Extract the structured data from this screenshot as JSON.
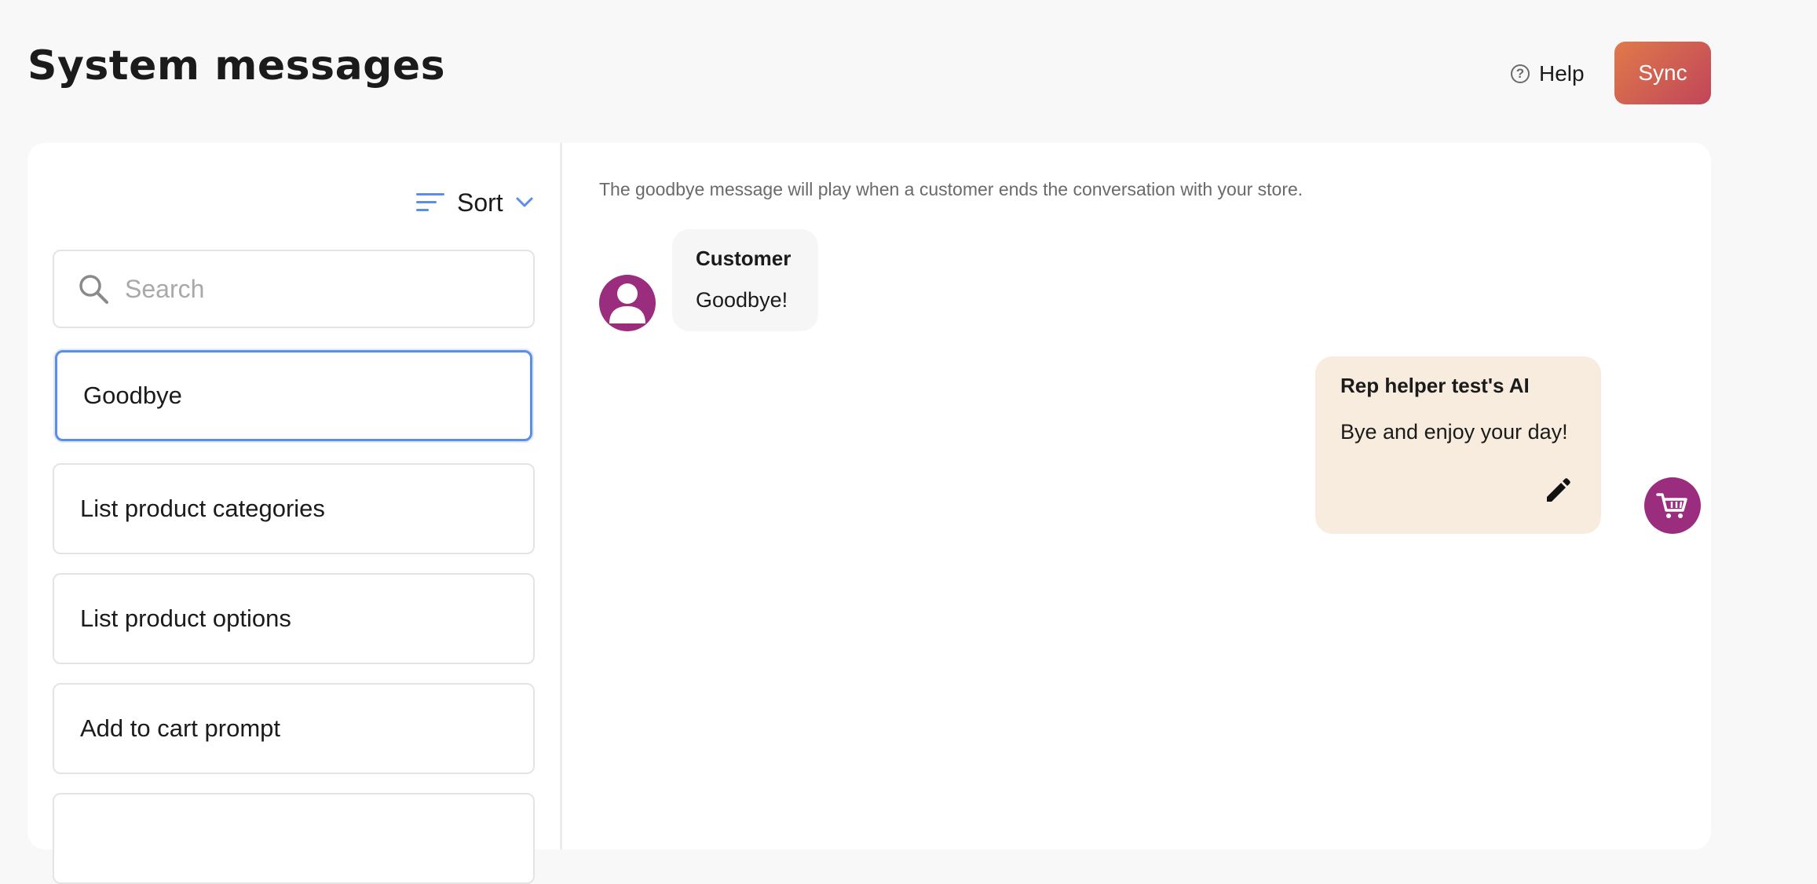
{
  "header": {
    "title": "System messages",
    "help_label": "Help",
    "sync_label": "Sync"
  },
  "sidebar": {
    "sort_label": "Sort",
    "search_placeholder": "Search",
    "items": [
      {
        "label": "Goodbye",
        "selected": true
      },
      {
        "label": "List product categories",
        "selected": false
      },
      {
        "label": "List product options",
        "selected": false
      },
      {
        "label": "Add to cart prompt",
        "selected": false
      },
      {
        "label": "",
        "selected": false
      }
    ]
  },
  "detail": {
    "description": "The goodbye message will play when a customer ends the conversation with your store.",
    "customer": {
      "name": "Customer",
      "message": "Goodbye!"
    },
    "ai": {
      "name": "Rep helper test's AI",
      "message": "Bye and enjoy your day!"
    }
  },
  "colors": {
    "accent_blue": "#5b8ee6",
    "avatar_purple": "#9b2d7e",
    "sync_gradient_start": "#e07a4a",
    "sync_gradient_end": "#c0455a",
    "ai_bubble": "#f7ecdd",
    "customer_bubble": "#f6f6f6"
  },
  "icons": {
    "help": "question-circle-icon",
    "sort": "sort-lines-icon",
    "sort_caret": "chevron-down-icon",
    "search": "search-icon",
    "customer_avatar": "user-icon",
    "ai_avatar": "cart-icon",
    "edit": "pencil-icon"
  }
}
